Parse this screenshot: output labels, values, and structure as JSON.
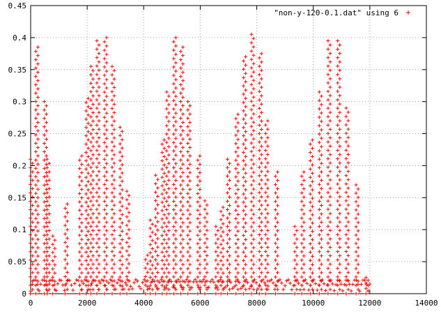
{
  "chart_data": {
    "type": "scatter",
    "title": "",
    "xlabel": "",
    "ylabel": "",
    "xlim": [
      0,
      14000
    ],
    "ylim": [
      0,
      0.45
    ],
    "x_ticks": [
      "0",
      "2000",
      "4000",
      "6000",
      "8000",
      "10000",
      "12000",
      "14000"
    ],
    "y_ticks": [
      "0",
      "0.05",
      "0.1",
      "0.15",
      "0.2",
      "0.25",
      "0.3",
      "0.35",
      "0.4",
      "0.45"
    ],
    "grid": true,
    "legend_position": "top-right",
    "marker": "+",
    "series": [
      {
        "name": "\"non-y-120-0.1.dat\" using 6",
        "color": "#ff0000",
        "x_range": [
          0,
          12000
        ],
        "peak_x": [
          30,
          220,
          520,
          620,
          820,
          1260,
          1770,
          2000,
          2170,
          2380,
          2650,
          2920,
          3200,
          3440,
          4100,
          4270,
          4460,
          4690,
          4850,
          5100,
          5350,
          5600,
          5950,
          6200,
          6590,
          6770,
          7000,
          7300,
          7570,
          7850,
          8130,
          8350,
          8700,
          9380,
          9630,
          9930,
          10250,
          10560,
          10900,
          11200,
          11550,
          11900
        ],
        "peak_y": [
          0.21,
          0.385,
          0.3,
          0.21,
          0.09,
          0.14,
          0.215,
          0.305,
          0.355,
          0.395,
          0.4,
          0.355,
          0.26,
          0.16,
          0.06,
          0.115,
          0.185,
          0.24,
          0.315,
          0.4,
          0.385,
          0.3,
          0.215,
          0.145,
          0.105,
          0.135,
          0.21,
          0.28,
          0.37,
          0.405,
          0.375,
          0.27,
          0.19,
          0.105,
          0.19,
          0.24,
          0.315,
          0.395,
          0.395,
          0.29,
          0.17,
          0.025
        ]
      }
    ]
  }
}
